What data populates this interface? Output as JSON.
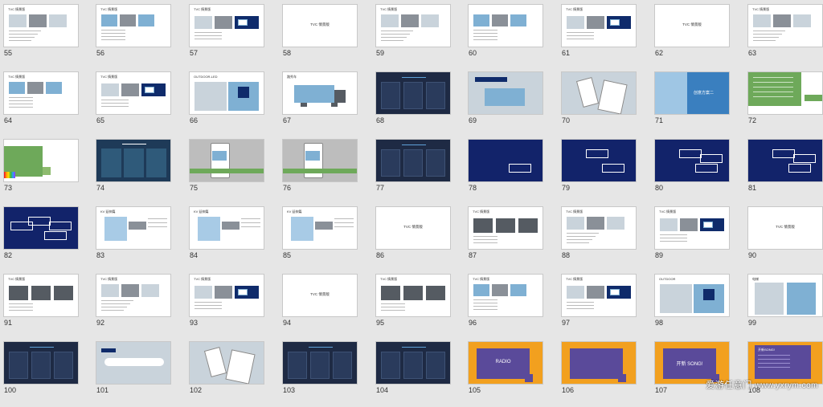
{
  "slides": [
    {
      "num": "55",
      "kind": "tvc-sketch",
      "title": "TVC 情景版"
    },
    {
      "num": "56",
      "kind": "tvc-photos",
      "title": "TVC 情景版"
    },
    {
      "num": "57",
      "kind": "tvc-dialog",
      "title": "TVC 情景版"
    },
    {
      "num": "58",
      "kind": "center-text",
      "title": "TVC 情景版"
    },
    {
      "num": "59",
      "kind": "tvc-sketch",
      "title": "TVC 情景版"
    },
    {
      "num": "60",
      "kind": "tvc-photos",
      "title": ""
    },
    {
      "num": "61",
      "kind": "tvc-dialog",
      "title": "TVC 情景版"
    },
    {
      "num": "62",
      "kind": "center-text",
      "title": "TVC 情景版"
    },
    {
      "num": "63",
      "kind": "tvc-sketch",
      "title": "TVC 情景版"
    },
    {
      "num": "64",
      "kind": "tvc-photos",
      "title": "TVC 情景版"
    },
    {
      "num": "65",
      "kind": "tvc-dialog",
      "title": "TVC 情景版"
    },
    {
      "num": "66",
      "kind": "outdoor",
      "title": "OUTDOOR-LED"
    },
    {
      "num": "67",
      "kind": "truck",
      "title": "路秀车"
    },
    {
      "num": "68",
      "kind": "navy-cols",
      "title": ""
    },
    {
      "num": "69",
      "kind": "building",
      "title": ""
    },
    {
      "num": "70",
      "kind": "phones",
      "title": ""
    },
    {
      "num": "71",
      "kind": "blue-photo",
      "title": "创意方案二"
    },
    {
      "num": "72",
      "kind": "green-text",
      "title": ""
    },
    {
      "num": "73",
      "kind": "color-bars",
      "title": ""
    },
    {
      "num": "74",
      "kind": "navy-panels",
      "title": ""
    },
    {
      "num": "75",
      "kind": "phone-green",
      "title": ""
    },
    {
      "num": "76",
      "kind": "phone-green",
      "title": ""
    },
    {
      "num": "77",
      "kind": "navy-cols",
      "title": ""
    },
    {
      "num": "78",
      "kind": "navy-bubble1",
      "title": ""
    },
    {
      "num": "79",
      "kind": "navy-bubble2",
      "title": ""
    },
    {
      "num": "80",
      "kind": "navy-bubble3",
      "title": ""
    },
    {
      "num": "81",
      "kind": "navy-bubble3",
      "title": ""
    },
    {
      "num": "82",
      "kind": "navy-bubble4",
      "title": ""
    },
    {
      "num": "83",
      "kind": "kv",
      "title": "KV 延伸篇"
    },
    {
      "num": "84",
      "kind": "kv",
      "title": "KV 延伸篇"
    },
    {
      "num": "85",
      "kind": "kv",
      "title": "KV 延伸篇"
    },
    {
      "num": "86",
      "kind": "center-text",
      "title": "TVC 情景版"
    },
    {
      "num": "87",
      "kind": "tvc-dark",
      "title": "TVC 情景版"
    },
    {
      "num": "88",
      "kind": "tvc-sketch",
      "title": "TVC 情景版"
    },
    {
      "num": "89",
      "kind": "tvc-dialog",
      "title": "TVC 情景版"
    },
    {
      "num": "90",
      "kind": "center-text",
      "title": "TVC 情景版"
    },
    {
      "num": "91",
      "kind": "tvc-dark",
      "title": "TVC 情景版"
    },
    {
      "num": "92",
      "kind": "tvc-sketch",
      "title": "TVC 情景版"
    },
    {
      "num": "93",
      "kind": "tvc-dialog",
      "title": "TVC 情景版"
    },
    {
      "num": "94",
      "kind": "center-text",
      "title": "TVC 情景版"
    },
    {
      "num": "95",
      "kind": "tvc-dark",
      "title": "TVC 情景版"
    },
    {
      "num": "96",
      "kind": "tvc-photos",
      "title": "TVC 情景版"
    },
    {
      "num": "97",
      "kind": "tvc-dialog",
      "title": "TVC 情景版"
    },
    {
      "num": "98",
      "kind": "outdoor",
      "title": "OUTDOOR"
    },
    {
      "num": "99",
      "kind": "elevator",
      "title": "电梯"
    },
    {
      "num": "100",
      "kind": "navy-cols",
      "title": ""
    },
    {
      "num": "101",
      "kind": "car-road",
      "title": ""
    },
    {
      "num": "102",
      "kind": "phones",
      "title": ""
    },
    {
      "num": "103",
      "kind": "navy-cols",
      "title": ""
    },
    {
      "num": "104",
      "kind": "navy-cols",
      "title": ""
    },
    {
      "num": "105",
      "kind": "orange",
      "title": "RADIO"
    },
    {
      "num": "106",
      "kind": "orange",
      "title": ""
    },
    {
      "num": "107",
      "kind": "orange",
      "title": "开新 SONG!"
    },
    {
      "num": "108",
      "kind": "orange-text",
      "title": "开新SONG!"
    }
  ],
  "watermark": {
    "cn": "爱游任意门",
    "url": "www.yxrym.com"
  },
  "colors": {
    "navy": "#0f2b6b",
    "green": "#6ea95a",
    "orange": "#f2a01f",
    "purple": "#5a4a9a",
    "background": "#e6e6e6"
  }
}
